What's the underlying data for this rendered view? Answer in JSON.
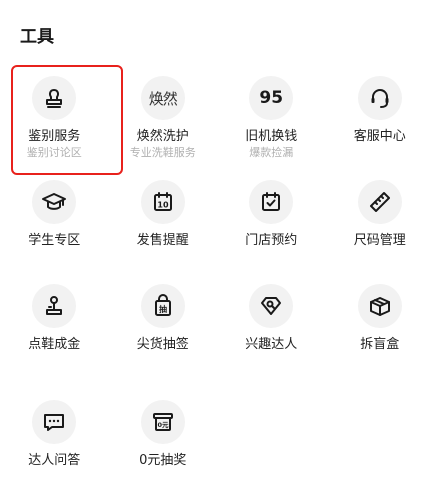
{
  "section": {
    "title": "工具"
  },
  "tools": [
    {
      "label": "鉴别服务",
      "sub": "鉴别讨论区",
      "icon": "stamp-icon"
    },
    {
      "label": "焕然洗护",
      "sub": "专业洗鞋服务",
      "icon": "huanran-logo-icon",
      "icon_text": "焕然"
    },
    {
      "label": "旧机换钱",
      "sub": "爆款捡漏",
      "icon": "recycle-95-icon",
      "icon_text": "95"
    },
    {
      "label": "客服中心",
      "sub": "",
      "icon": "headset-icon"
    },
    {
      "label": "学生专区",
      "sub": "",
      "icon": "graduation-cap-icon"
    },
    {
      "label": "发售提醒",
      "sub": "",
      "icon": "calendar-10-icon",
      "icon_text": "10"
    },
    {
      "label": "门店预约",
      "sub": "",
      "icon": "calendar-check-icon"
    },
    {
      "label": "尺码管理",
      "sub": "",
      "icon": "ruler-icon"
    },
    {
      "label": "点鞋成金",
      "sub": "",
      "icon": "joystick-icon"
    },
    {
      "label": "尖货抽签",
      "sub": "",
      "icon": "lottery-bag-icon",
      "icon_text": "抽"
    },
    {
      "label": "兴趣达人",
      "sub": "",
      "icon": "diamond-search-icon"
    },
    {
      "label": "拆盲盒",
      "sub": "",
      "icon": "blind-box-icon"
    },
    {
      "label": "达人问答",
      "sub": "",
      "icon": "chat-bubble-icon"
    },
    {
      "label": "0元抽奖",
      "sub": "",
      "icon": "zero-yuan-lottery-icon",
      "icon_text": "0元"
    }
  ],
  "colors": {
    "highlight": "#e8211c",
    "icon_bg": "#f2f2f2",
    "sub_text": "#b0b0b0"
  }
}
